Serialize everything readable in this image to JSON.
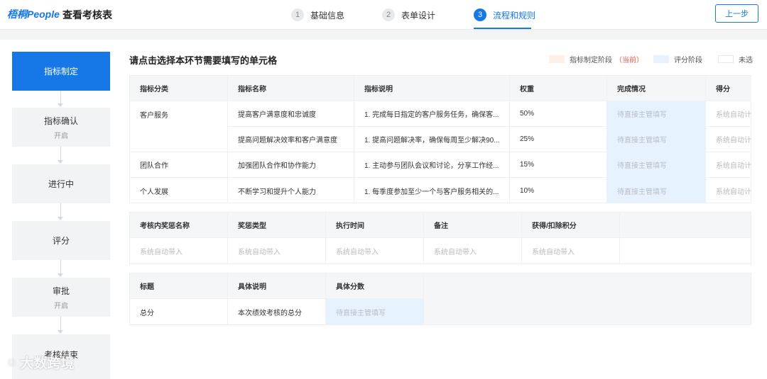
{
  "header": {
    "logo": "梧桐People",
    "title": "查看考核表",
    "steps": [
      {
        "num": "1",
        "label": "基础信息"
      },
      {
        "num": "2",
        "label": "表单设计"
      },
      {
        "num": "3",
        "label": "流程和规则"
      }
    ],
    "prev_button": "上一步"
  },
  "flow": [
    {
      "label": "指标制定",
      "sub": ""
    },
    {
      "label": "指标确认",
      "sub": "开启"
    },
    {
      "label": "进行中",
      "sub": ""
    },
    {
      "label": "评分",
      "sub": ""
    },
    {
      "label": "审批",
      "sub": "开启"
    },
    {
      "label": "考核结束",
      "sub": ""
    }
  ],
  "main": {
    "title": "请点击选择本环节需要填写的单元格",
    "legend": {
      "phase_define": "指标制定阶段",
      "current": "（当前）",
      "phase_score": "评分阶段",
      "unselected": "未选"
    }
  },
  "table1": {
    "headers": [
      "指标分类",
      "指标名称",
      "指标说明",
      "权重",
      "完成情况",
      "得分"
    ],
    "rows": [
      {
        "category": "客户服务",
        "name": "提高客户满意度和忠诚度",
        "desc": "1. 完成每日指定的客户服务任务，确保客...",
        "weight": "50%",
        "completion": "待直接主管填写",
        "score": "系统自动计算"
      },
      {
        "category": "",
        "name": "提高问题解决效率和客户满意度",
        "desc": "1. 提高问题解决率，确保每周至少解决90...",
        "weight": "25%",
        "completion": "待直接主管填写",
        "score": "系统自动计算"
      },
      {
        "category": "团队合作",
        "name": "加强团队合作和协作能力",
        "desc": "1. 主动参与团队会议和讨论，分享工作经...",
        "weight": "15%",
        "completion": "待直接主管填写",
        "score": "系统自动计算"
      },
      {
        "category": "个人发展",
        "name": "不断学习和提升个人能力",
        "desc": "1. 每季度参加至少一个与客户服务相关的...",
        "weight": "10%",
        "completion": "待直接主管填写",
        "score": "系统自动计算"
      }
    ]
  },
  "table2": {
    "headers": [
      "考核内奖惩名称",
      "奖惩类型",
      "执行时间",
      "备注",
      "获得/扣除积分"
    ],
    "row": [
      "系统自动带入",
      "系统自动带入",
      "系统自动带入",
      "系统自动带入",
      "系统自动带入"
    ]
  },
  "table3": {
    "headers": [
      "标题",
      "具体说明",
      "具体分数"
    ],
    "row": [
      "总分",
      "本次绩效考核的总分",
      "待直接主管填写"
    ]
  },
  "watermark": "大数跨境",
  "colors": {
    "accent": "#1677e6",
    "phase_define_swatch": "#fdf1e6",
    "phase_score_swatch": "#e6f2fd"
  }
}
